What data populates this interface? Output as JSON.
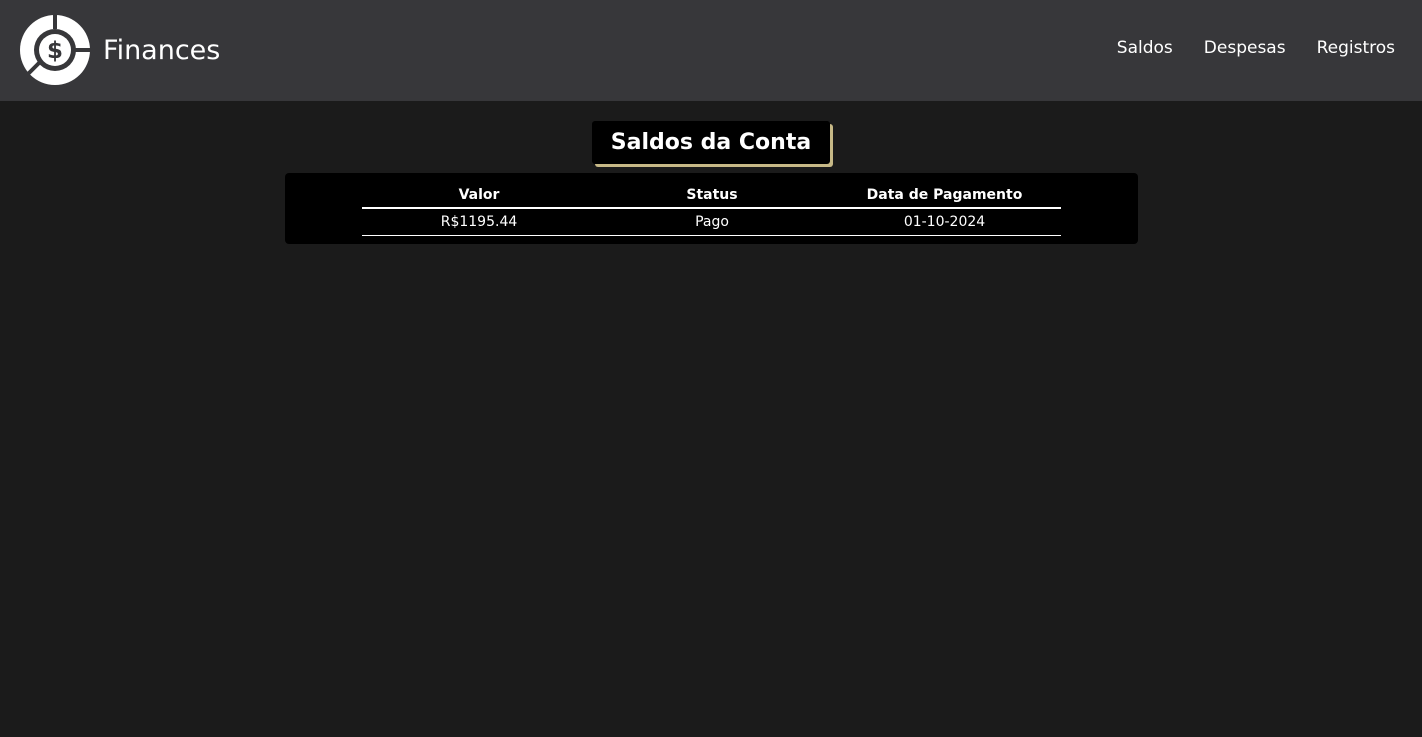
{
  "brand": {
    "name": "Finances",
    "logo_icon": "dollar-coin-pie-icon",
    "logo_color": "#ffffff"
  },
  "nav": {
    "items": [
      {
        "label": "Saldos"
      },
      {
        "label": "Despesas"
      },
      {
        "label": "Registros"
      }
    ]
  },
  "page": {
    "title": "Saldos da Conta",
    "title_accent_color": "#c7b987"
  },
  "table": {
    "headers": [
      "Valor",
      "Status",
      "Data de Pagamento"
    ],
    "rows": [
      [
        "R$1195.44",
        "Pago",
        "01-10-2024"
      ]
    ]
  },
  "colors": {
    "navbar_bg": "#37373a",
    "page_bg": "#1b1b1b",
    "panel_bg": "#000000"
  }
}
